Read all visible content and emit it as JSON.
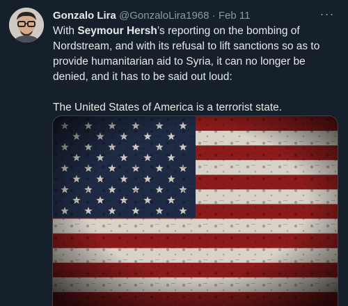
{
  "tweet": {
    "author_name": "Gonzalo Lira",
    "author_handle": "@GonzaloLira1968",
    "separator": "·",
    "timestamp": "Feb 11",
    "more_icon": "more-horizontal-icon",
    "text_part1": "With ",
    "text_bold": "Seymour Hersh",
    "text_part2": "’s reporting on the bombing of Nordstream, and with its refusal to lift sanctions so as to provide humanitarian aid to Syria, it can no longer be denied, and it has to be said out loud:",
    "text_paragraph2": "The United States of America is a terrorist state.",
    "media_description_icon": "american-flag-image"
  },
  "colors": {
    "background": "#15202b",
    "text": "#e7e9ea",
    "secondary_text": "#8b98a5",
    "flag_red": "#8e1b1b",
    "flag_white": "#d8d2c8",
    "flag_blue": "#1f2a44"
  }
}
